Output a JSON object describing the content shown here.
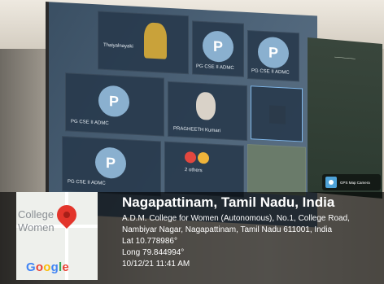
{
  "meeting_tiles": {
    "tile1_name": "Thaiyalnayaki",
    "tile2_name": "PG CSE II ADMC",
    "tile3_name": "PG CSE II ADMC",
    "tile4_name": "PG CSE II ADMC",
    "tile5_name": "PRAGHEETH Kumari",
    "tile6_name": "PG CSE II ADMC",
    "tile7_name": "2 others",
    "avatar_letter": "P"
  },
  "camera_badge": {
    "label": "GPS Map Camera"
  },
  "map": {
    "label_line1": "College",
    "label_line2": "Women",
    "brand": "Google"
  },
  "geo": {
    "title": "Nagapattinam, Tamil Nadu, India",
    "address_line1": "A.D.M. College for Women (Autonomous), No.1, College Road,",
    "address_line2": "Nambiyar Nagar, Nagapattinam, Tamil Nadu 611001, India",
    "lat": "Lat 10.778986°",
    "long": "Long 79.844994°",
    "datetime": "10/12/21 11:41 AM"
  }
}
